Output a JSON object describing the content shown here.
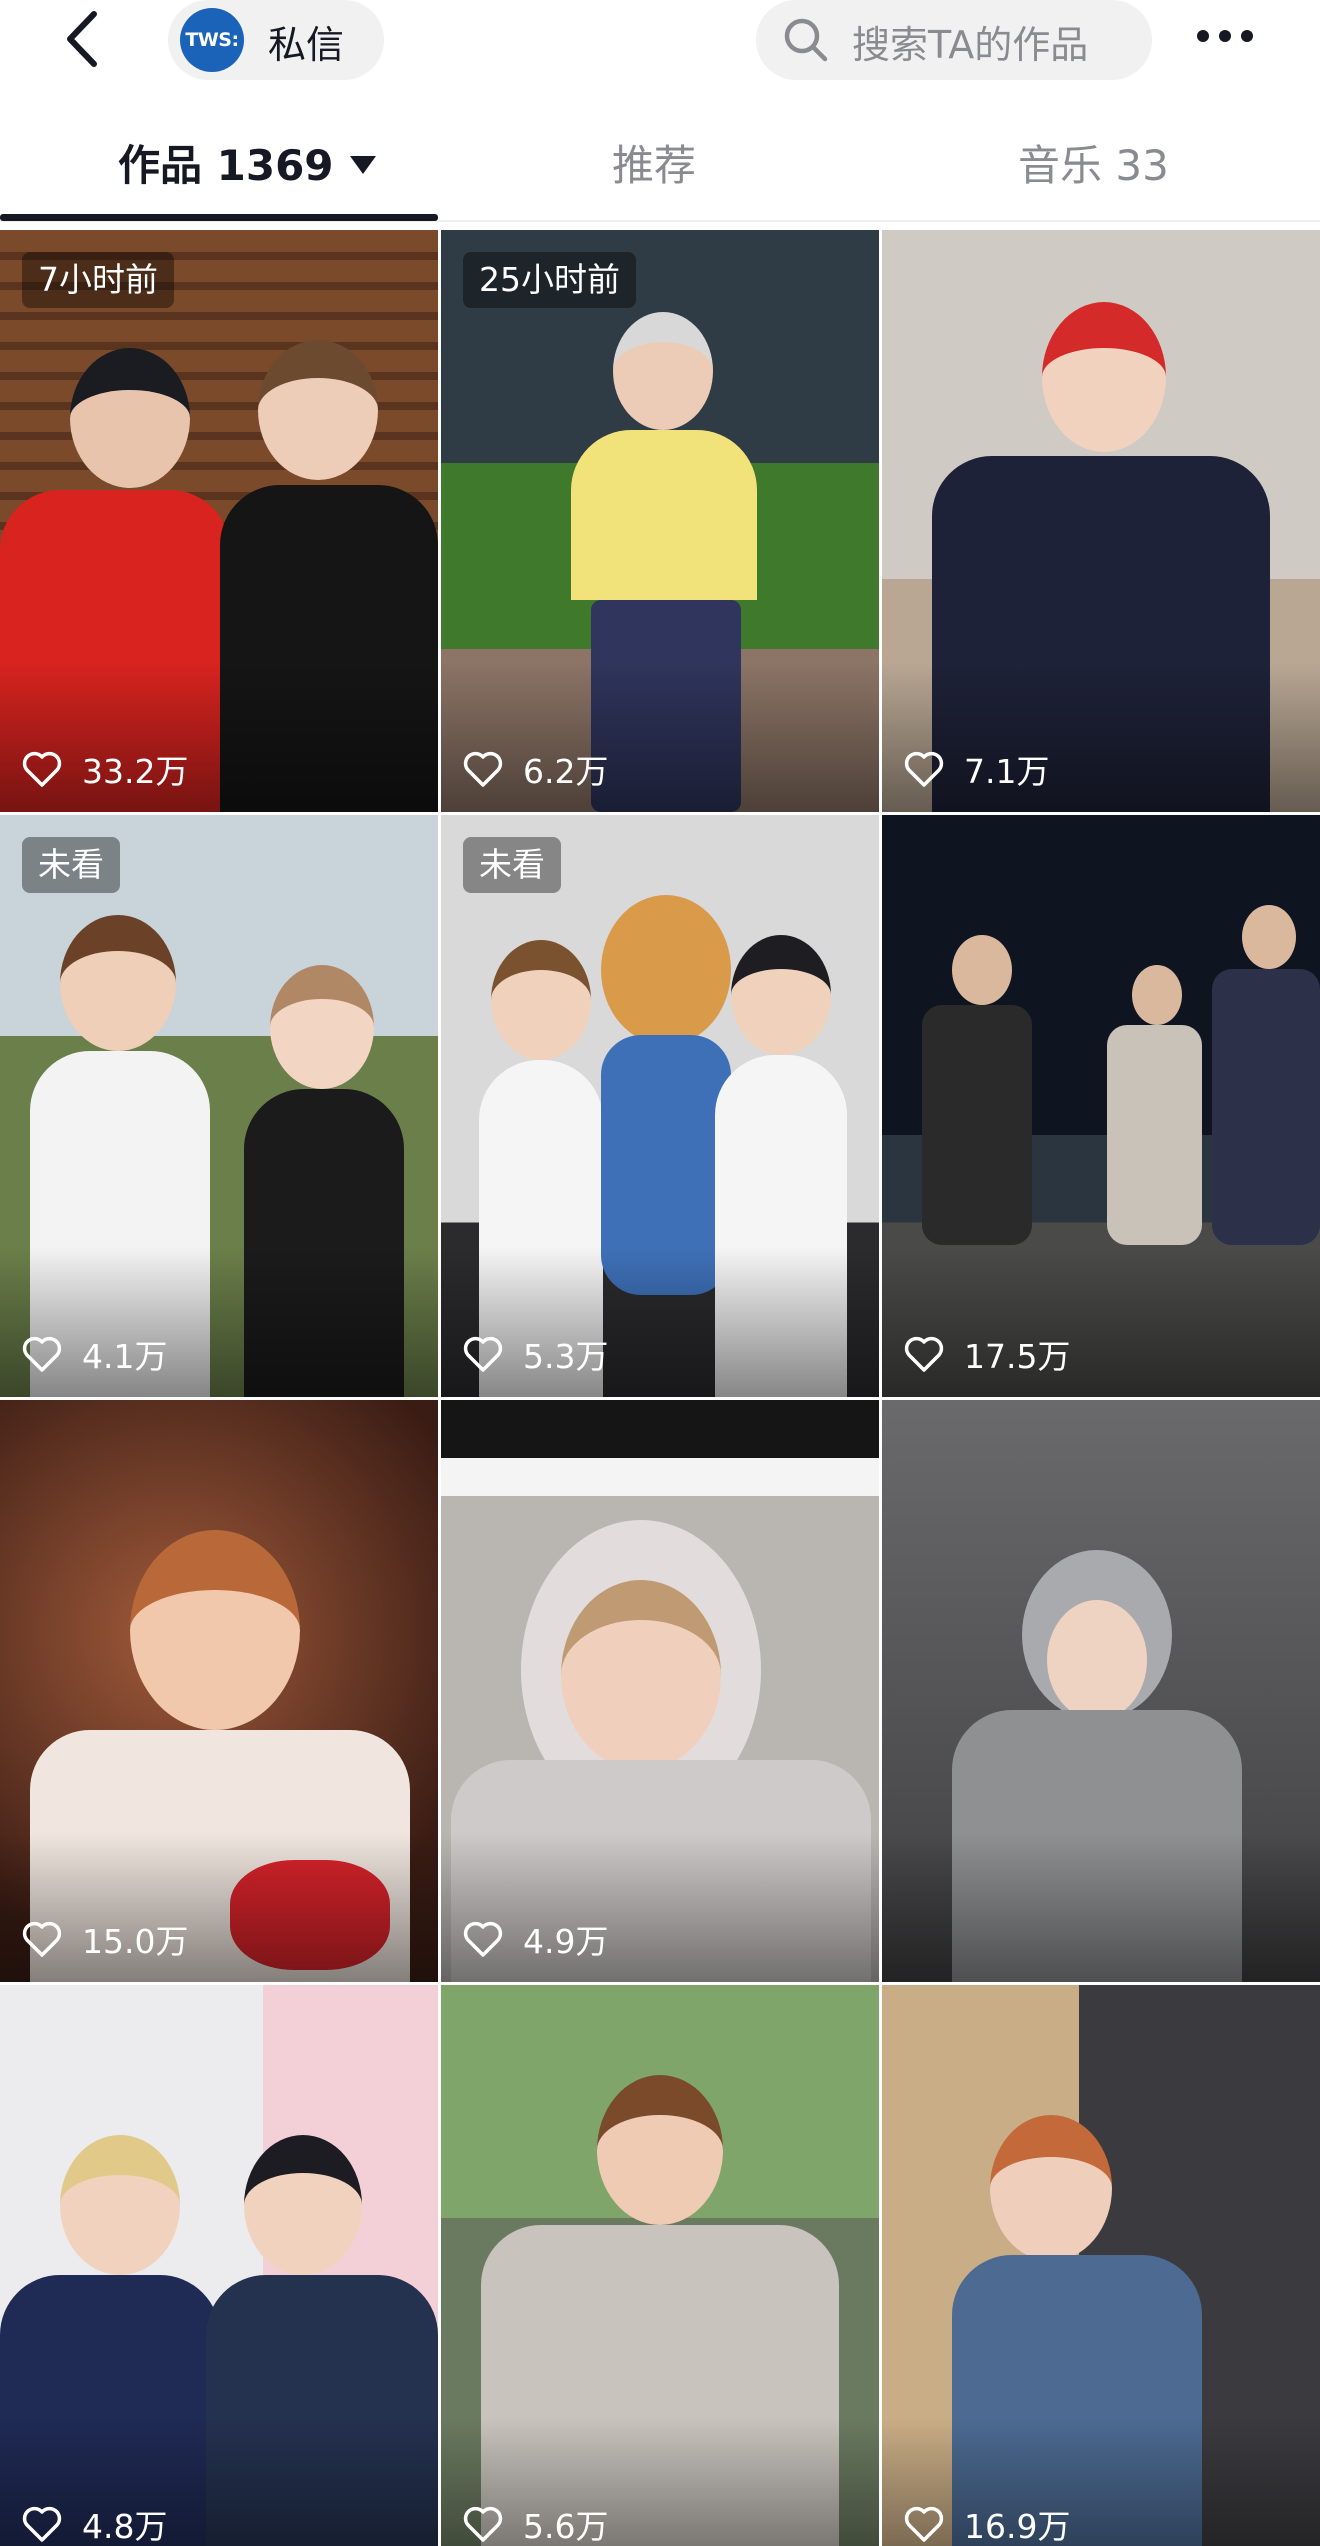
{
  "header": {
    "dm_avatar_text": "TWS:",
    "dm_label": "私信",
    "search_placeholder": "搜索TA的作品"
  },
  "tabs": [
    {
      "label": "作品 1369",
      "active": true
    },
    {
      "label": "推荐",
      "active": false
    },
    {
      "label": "音乐 33",
      "active": false
    }
  ],
  "videos": [
    {
      "badge": "7小时前",
      "likes": "33.2万"
    },
    {
      "badge": "25小时前",
      "likes": "6.2万"
    },
    {
      "badge": "",
      "likes": "7.1万"
    },
    {
      "badge": "未看",
      "likes": "4.1万"
    },
    {
      "badge": "未看",
      "likes": "5.3万"
    },
    {
      "badge": "",
      "likes": "17.5万"
    },
    {
      "badge": "",
      "likes": "15.0万"
    },
    {
      "badge": "",
      "likes": "4.9万"
    },
    {
      "badge": "",
      "likes": ""
    },
    {
      "badge": "",
      "likes": "4.8万"
    },
    {
      "badge": "",
      "likes": "5.6万"
    },
    {
      "badge": "",
      "likes": "16.9万"
    }
  ],
  "icons": {
    "back": "chevron-left-icon",
    "search": "search-icon",
    "more": "more-dots-icon",
    "like": "heart-icon"
  },
  "colors": {
    "avatar_bg": "#1a63b8",
    "active_tab": "#161823",
    "inactive_tab": "#8a8b91",
    "pill_bg": "#f1f1f2"
  }
}
